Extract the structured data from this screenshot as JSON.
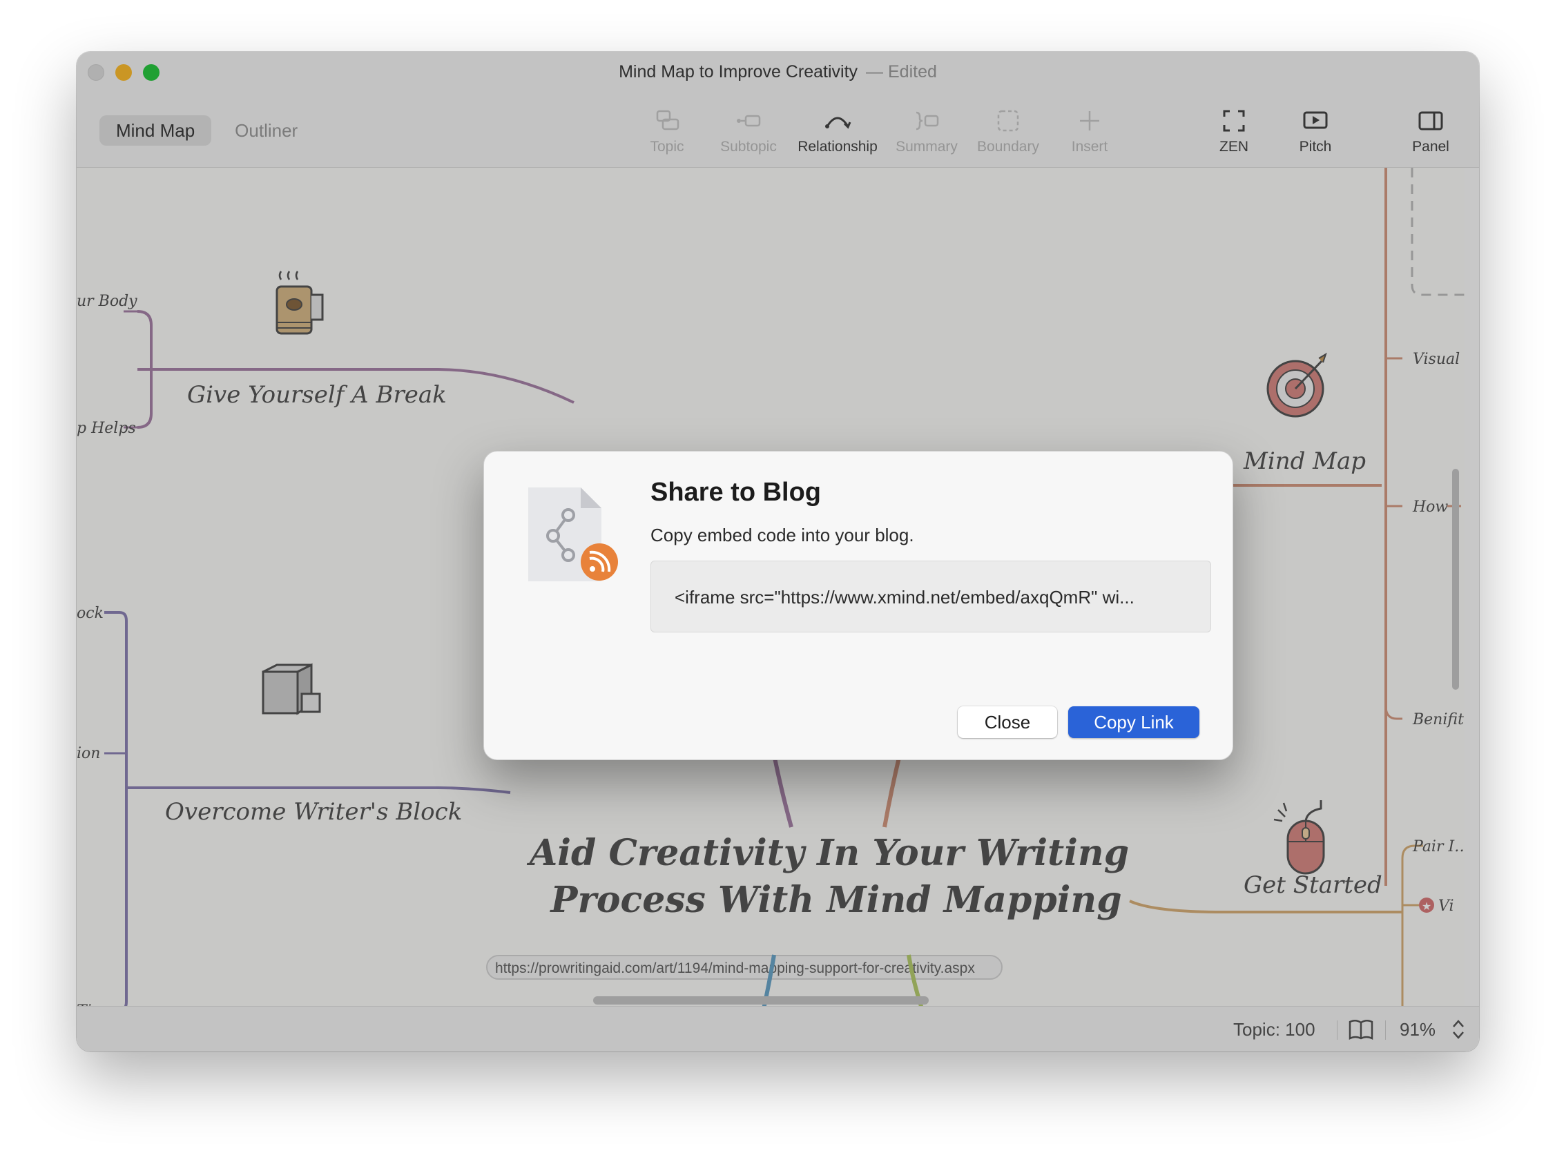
{
  "window": {
    "title": "Mind Map to Improve Creativity",
    "status": "— Edited"
  },
  "view_tabs": [
    {
      "label": "Mind Map",
      "active": true
    },
    {
      "label": "Outliner",
      "active": false
    }
  ],
  "toolbar": {
    "topic": "Topic",
    "subtopic": "Subtopic",
    "relationship": "Relationship",
    "summary": "Summary",
    "boundary": "Boundary",
    "insert": "Insert",
    "zen": "ZEN",
    "pitch": "Pitch",
    "panel": "Panel"
  },
  "map": {
    "central_line1": "Aid Creativity In Your Writing",
    "central_line2": "Process With Mind Mapping",
    "central_link": "https://prowritingaid.com/art/1194/mind-mapping-support-for-creativity.aspx",
    "left_topics": {
      "break": "Give Yourself A Break",
      "block": "Overcome Writer's Block"
    },
    "left_subtopics": {
      "body": "ur Body",
      "helps": "p Helps",
      "ock": "ock",
      "ion": "ion",
      "tips": "Tips"
    },
    "right_topics": {
      "mindmap": "Mind Map",
      "started": "Get Started"
    },
    "right_subtopics": {
      "visual": "Visual ...",
      "how": "How",
      "benefit": "Benifit...",
      "pair": "Pair I…",
      "vi": "Vi"
    }
  },
  "statusbar": {
    "topic_count": "Topic: 100",
    "zoom": "91%"
  },
  "dialog": {
    "title": "Share to Blog",
    "subtitle": "Copy embed code into your blog.",
    "embed_code": "<iframe src=\"https://www.xmind.net/embed/axqQmR\" wi...",
    "close_label": "Close",
    "copy_label": "Copy Link",
    "accent_color": "#2a63d8",
    "rss_color": "#e8823a"
  }
}
